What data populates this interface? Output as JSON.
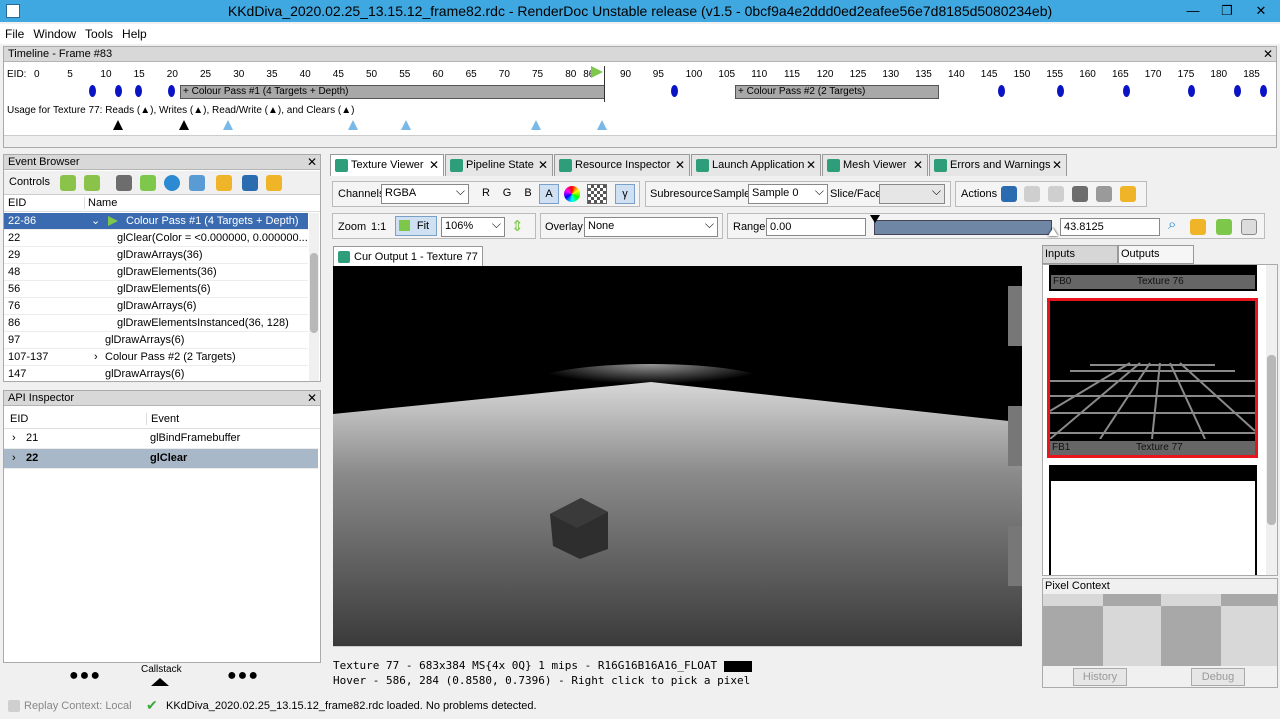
{
  "window": {
    "title": "KKdDiva_2020.02.25_13.15.12_frame82.rdc - RenderDoc Unstable release (v1.5 - 0bcf9a4e2ddd0ed2eafee56e7d8185d5080234eb)",
    "min": "—",
    "max": "❐",
    "close": "✕"
  },
  "menu": [
    "File",
    "Window",
    "Tools",
    "Help"
  ],
  "timeline": {
    "header": "Timeline - Frame #83",
    "eid_label": "EID:",
    "ticks": [
      "0",
      "5",
      "10",
      "15",
      "20",
      "25",
      "30",
      "35",
      "40",
      "45",
      "50",
      "55",
      "60",
      "65",
      "70",
      "75",
      "80",
      "86",
      "90",
      "95",
      "100",
      "105",
      "110",
      "115",
      "120",
      "125",
      "130",
      "135",
      "140",
      "145",
      "150",
      "155",
      "160",
      "165",
      "170",
      "175",
      "180",
      "185"
    ],
    "pass1": "+ Colour Pass #1 (4 Targets + Depth)",
    "pass2": "+ Colour Pass #2 (2 Targets)",
    "usage": "Usage for Texture 77: Reads (▲), Writes (▲), Read/Write (▲), and Clears (▲)"
  },
  "event_browser": {
    "header": "Event Browser",
    "controls": "Controls",
    "col_eid": "EID",
    "col_name": "Name",
    "rows": [
      {
        "eid": "22-86",
        "name": "Colour Pass #1 (4 Targets + Depth)"
      },
      {
        "eid": "22",
        "name": "glClear(Color = <0.000000, 0.000000..."
      },
      {
        "eid": "29",
        "name": "glDrawArrays(36)"
      },
      {
        "eid": "48",
        "name": "glDrawElements(36)"
      },
      {
        "eid": "56",
        "name": "glDrawElements(6)"
      },
      {
        "eid": "76",
        "name": "glDrawArrays(6)"
      },
      {
        "eid": "86",
        "name": "glDrawElementsInstanced(36, 128)"
      },
      {
        "eid": "97",
        "name": "glDrawArrays(6)"
      },
      {
        "eid": "107-137",
        "name": "Colour Pass #2 (2 Targets)"
      },
      {
        "eid": "147",
        "name": "glDrawArrays(6)"
      }
    ]
  },
  "api_inspector": {
    "header": "API Inspector",
    "col_eid": "EID",
    "col_event": "Event",
    "rows": [
      {
        "eid": "21",
        "event": "glBindFramebuffer"
      },
      {
        "eid": "22",
        "event": "glClear"
      }
    ],
    "callstack": "Callstack"
  },
  "tabs": [
    "Texture Viewer",
    "Pipeline State",
    "Resource Inspector",
    "Launch Application",
    "Mesh Viewer",
    "Errors and Warnings"
  ],
  "texture_viewer": {
    "channels_label": "Channels",
    "channels_value": "RGBA",
    "r": "R",
    "g": "G",
    "b": "B",
    "a": "A",
    "gamma": "γ",
    "subresource": "Subresource",
    "sample_label": "Sample",
    "sample_value": "Sample 0",
    "slice_label": "Slice/Face",
    "actions": "Actions",
    "zoom_label": "Zoom",
    "one_to_one": "1:1",
    "fit": "Fit",
    "zoom_value": "106%",
    "overlay_label": "Overlay",
    "overlay_value": "None",
    "range_label": "Range",
    "range_min": "0.00",
    "range_max": "43.8125",
    "output_tab": "Cur Output 1 - Texture 77",
    "status_line": "Texture 77 - 683x384 MS{4x 0Q} 1 mips - R16G16B16A16_FLOAT",
    "hover_line": "Hover -  586,  284 (0.8580, 0.7396) - Right click to pick a pixel"
  },
  "thumbnails": {
    "inputs_tab": "Inputs",
    "outputs_tab": "Outputs",
    "items": [
      {
        "slot": "FB0",
        "name": "Texture 76"
      },
      {
        "slot": "FB1",
        "name": "Texture 77"
      }
    ]
  },
  "pixel_context": {
    "header": "Pixel Context",
    "history": "History",
    "debug": "Debug"
  },
  "statusbar": {
    "replay": "Replay Context: Local",
    "message": "KKdDiva_2020.02.25_13.15.12_frame82.rdc loaded. No problems detected."
  }
}
